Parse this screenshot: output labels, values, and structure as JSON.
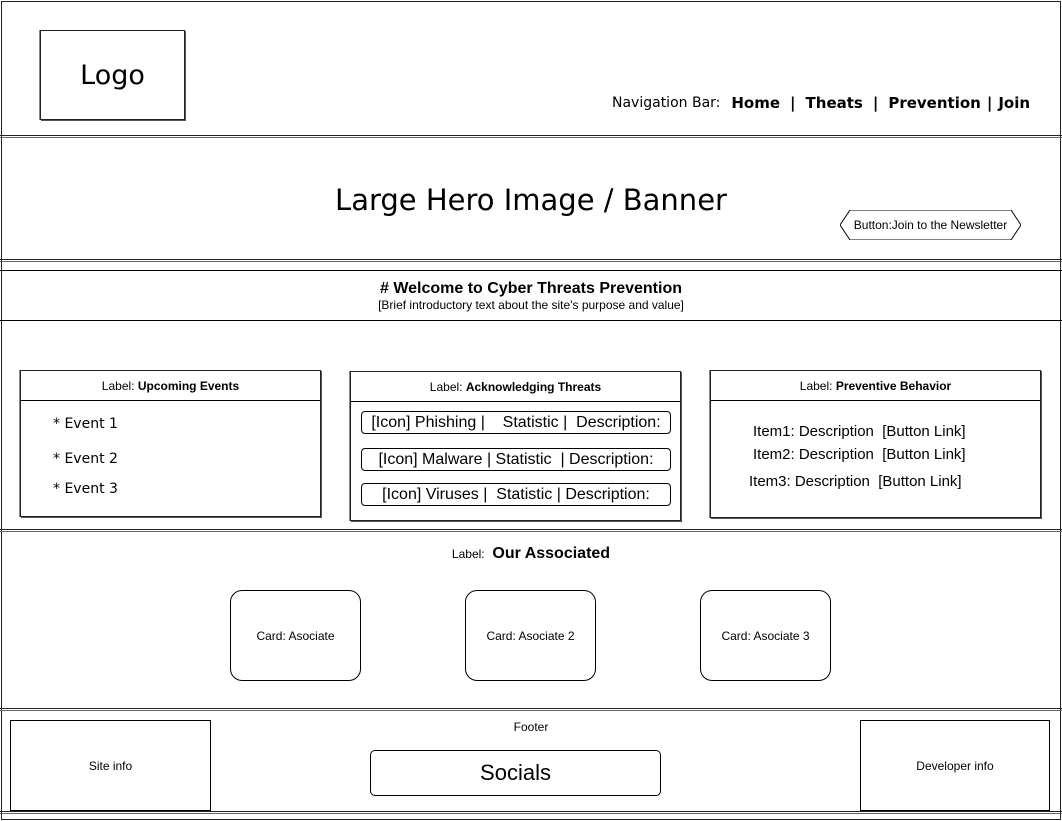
{
  "header": {
    "logo": "Logo",
    "nav_label": "Navigation Bar:",
    "nav_items": [
      "Home",
      "Theats",
      "Prevention",
      "Join"
    ],
    "separator": "|"
  },
  "hero": {
    "text": "Large Hero Image / Banner",
    "button": "Button:Join to the Newsletter"
  },
  "welcome": {
    "prefix": "#",
    "title": "# Welcome to Cyber Threats Prevention",
    "subtitle": "[Brief introductory text about the site's purpose and value]"
  },
  "panels": {
    "events": {
      "label_prefix": "Label: ",
      "label": "Upcoming Events",
      "items": [
        "* Event 1",
        "* Event 2",
        "* Event 3"
      ]
    },
    "threats": {
      "label_prefix": "Label: ",
      "label": "Acknowledging Threats",
      "rows": [
        "[Icon] Phishing |    Statistic |  Description:",
        "[Icon] Malware | Statistic  | Description:",
        "[Icon] Viruses |  Statistic | Description:"
      ]
    },
    "prevention": {
      "label_prefix": "Label: ",
      "label": "Preventive Behavior",
      "items": [
        "Item1: Description  [Button Link]",
        "Item2: Description  [Button Link]",
        "Item3: Description  [Button Link]"
      ]
    }
  },
  "associates": {
    "label_prefix": "Label: ",
    "title": "Our Associated",
    "cards": [
      "Card: Asociate",
      "Card: Asociate 2",
      "Card: Asociate 3"
    ]
  },
  "footer": {
    "title": "Footer",
    "site_info": "Site info",
    "socials": "Socials",
    "developer_info": "Developer info"
  }
}
